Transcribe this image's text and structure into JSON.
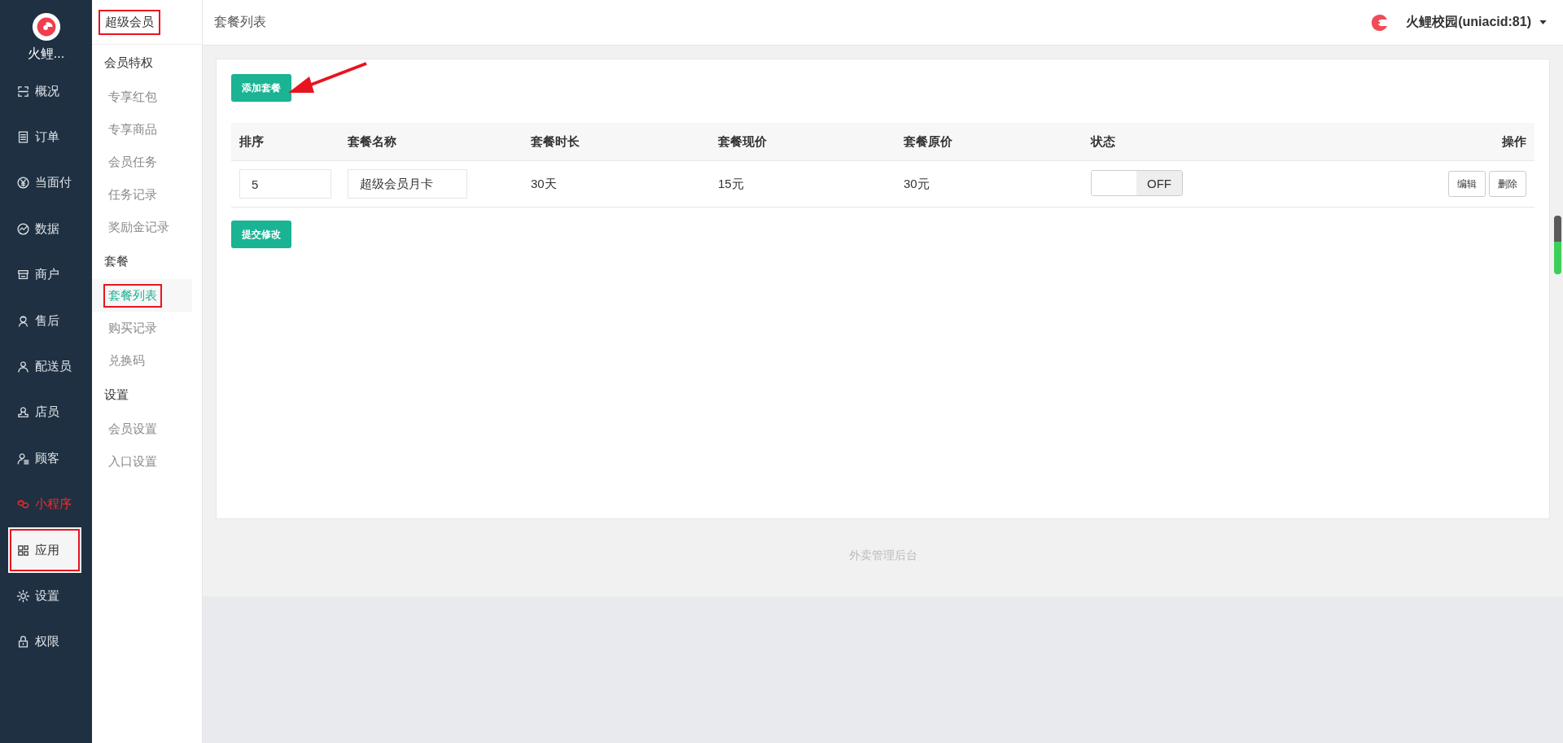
{
  "nav": {
    "brand": "火鲤...",
    "items": [
      {
        "label": "概况",
        "selected": false,
        "annotated": false,
        "color": "#dfe3e8"
      },
      {
        "label": "订单",
        "selected": false,
        "annotated": false,
        "color": "#dfe3e8"
      },
      {
        "label": "当面付",
        "selected": false,
        "annotated": false,
        "color": "#dfe3e8"
      },
      {
        "label": "数据",
        "selected": false,
        "annotated": false,
        "color": "#dfe3e8"
      },
      {
        "label": "商户",
        "selected": false,
        "annotated": false,
        "color": "#dfe3e8"
      },
      {
        "label": "售后",
        "selected": false,
        "annotated": false,
        "color": "#dfe3e8"
      },
      {
        "label": "配送员",
        "selected": false,
        "annotated": false,
        "color": "#dfe3e8"
      },
      {
        "label": "店员",
        "selected": false,
        "annotated": false,
        "color": "#dfe3e8"
      },
      {
        "label": "顾客",
        "selected": false,
        "annotated": false,
        "color": "#dfe3e8"
      },
      {
        "label": "小程序",
        "selected": false,
        "annotated": false,
        "color": "#ff2a2a"
      },
      {
        "label": "应用",
        "selected": true,
        "annotated": true,
        "color": "#333333"
      },
      {
        "label": "设置",
        "selected": false,
        "annotated": false,
        "color": "#dfe3e8"
      },
      {
        "label": "权限",
        "selected": false,
        "annotated": false,
        "color": "#dfe3e8"
      }
    ]
  },
  "submenu": {
    "title": "超级会员",
    "title_annotated": true,
    "groups": [
      {
        "heading": "会员特权",
        "items": [
          {
            "label": "专享红包",
            "selected": false,
            "annotated": false
          },
          {
            "label": "专享商品",
            "selected": false,
            "annotated": false
          },
          {
            "label": "会员任务",
            "selected": false,
            "annotated": false
          },
          {
            "label": "任务记录",
            "selected": false,
            "annotated": false
          },
          {
            "label": "奖励金记录",
            "selected": false,
            "annotated": false
          }
        ]
      },
      {
        "heading": "套餐",
        "items": [
          {
            "label": "套餐列表",
            "selected": true,
            "annotated": true
          },
          {
            "label": "购买记录",
            "selected": false,
            "annotated": false
          },
          {
            "label": "兑换码",
            "selected": false,
            "annotated": false
          }
        ]
      },
      {
        "heading": "设置",
        "items": [
          {
            "label": "会员设置",
            "selected": false,
            "annotated": false
          },
          {
            "label": "入口设置",
            "selected": false,
            "annotated": false
          }
        ]
      }
    ]
  },
  "header": {
    "title": "套餐列表",
    "account": "火鲤校园(uniacid:81)"
  },
  "add_button": "添加套餐",
  "table": {
    "columns": [
      "排序",
      "套餐名称",
      "套餐时长",
      "套餐现价",
      "套餐原价",
      "状态",
      "操作"
    ],
    "rows": [
      {
        "order": "5",
        "name": "超级会员月卡",
        "duration": "30天",
        "price": "15元",
        "original_price": "30元",
        "status": {
          "on": false,
          "label": "OFF"
        },
        "actions": [
          "编辑",
          "删除"
        ]
      }
    ]
  },
  "submit_button": "提交修改",
  "footer": "外卖管理后台"
}
